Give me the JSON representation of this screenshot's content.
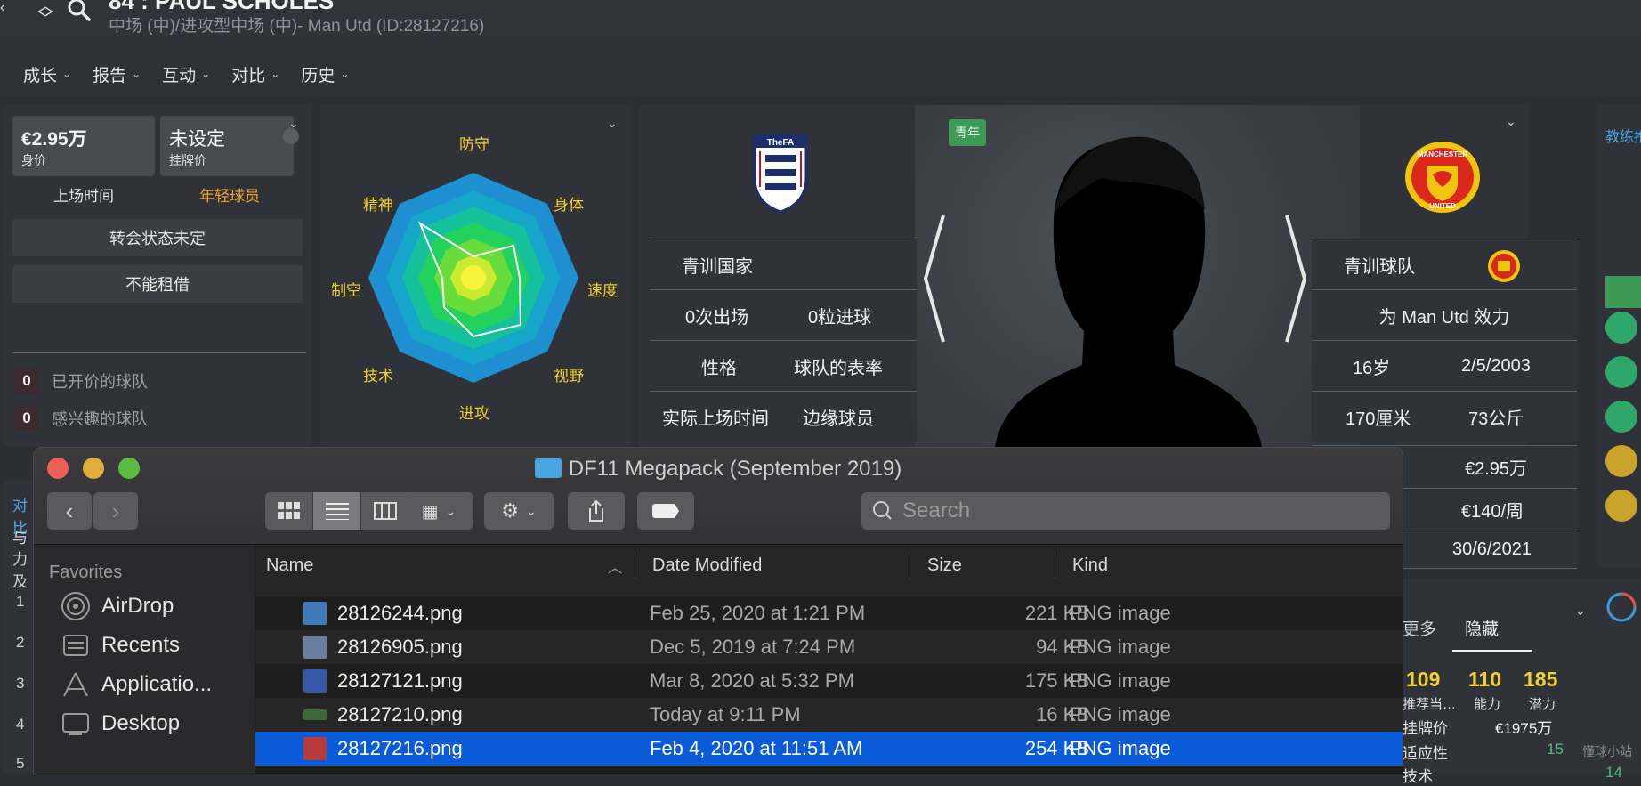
{
  "header": {
    "title": "84 : PAUL SCHOLES",
    "subtitle": "中场 (中)/进攻型中场 (中)- Man Utd (ID:28127216)",
    "nav": [
      "成长",
      "报告",
      "互动",
      "对比",
      "历史"
    ]
  },
  "value_panel": {
    "value": "€2.95万",
    "value_label": "身价",
    "asking": "未设定",
    "asking_label": "挂牌价",
    "playing_time": "上场时间",
    "player_type": "年轻球员",
    "transfer_status": "转会状态未定",
    "loan_status": "不能租借",
    "offers_count": "0",
    "offers_label": "已开价的球队",
    "interest_count": "0",
    "interest_label": "感兴趣的球队"
  },
  "radar": {
    "labels": [
      "防守",
      "身体",
      "速度",
      "视野",
      "进攻",
      "技术",
      "制空",
      "精神"
    ]
  },
  "player_card": {
    "youth_tag": "青年",
    "left_rows": [
      [
        "青训国家",
        ""
      ],
      [
        "0次出场",
        "0粒进球"
      ],
      [
        "性格",
        "球队的表率"
      ],
      [
        "实际上场时间",
        "边缘球员"
      ]
    ],
    "right_rows": [
      [
        "青训球队",
        ""
      ],
      [
        "为 Man Utd 效力",
        ""
      ],
      [
        "16岁",
        "2/5/2003"
      ],
      [
        "170厘米",
        "73公斤"
      ],
      [
        "",
        "€2.95万"
      ],
      [
        "",
        "€140/周"
      ],
      [
        "",
        "30/6/2021"
      ]
    ],
    "fa_text": "TheFA",
    "club_text_top": "MANCHESTER",
    "club_text_bottom": "UNITED"
  },
  "right_edge": {
    "coach_label": "教练推",
    "tab_more": "更多",
    "tab_hidden": "隐藏",
    "stats": [
      {
        "value": "109",
        "label": "推荐当…"
      },
      {
        "value": "110",
        "label": "能力"
      },
      {
        "value": "185",
        "label": "潜力"
      }
    ],
    "asking_label": "挂牌价",
    "asking_value": "€1975万",
    "adapt_label": "适应性",
    "adapt_value": "15",
    "next_label": "技术",
    "next_value": "14",
    "watermark": "懂球小站"
  },
  "bg_partial": {
    "left_labels": [
      "对比",
      "与",
      "力及"
    ],
    "row_numbers": [
      "1",
      "2",
      "3",
      "4",
      "5"
    ]
  },
  "finder": {
    "title": "DF11 Megapack (September 2019)",
    "search_placeholder": "Search",
    "sidebar_heading": "Favorites",
    "sidebar_items": [
      "AirDrop",
      "Recents",
      "Applicatio...",
      "Desktop"
    ],
    "columns": {
      "name": "Name",
      "date": "Date Modified",
      "size": "Size",
      "kind": "Kind"
    },
    "files": [
      {
        "name": "28126244.png",
        "date": "Feb 25, 2020 at 1:21 PM",
        "size": "221 KB",
        "kind": "PNG image"
      },
      {
        "name": "28126905.png",
        "date": "Dec 5, 2019 at 7:24 PM",
        "size": "94 KB",
        "kind": "PNG image"
      },
      {
        "name": "28127121.png",
        "date": "Mar 8, 2020 at 5:32 PM",
        "size": "175 KB",
        "kind": "PNG image"
      },
      {
        "name": "28127210.png",
        "date": "Today at 9:11 PM",
        "size": "16 KB",
        "kind": "PNG image"
      },
      {
        "name": "28127216.png",
        "date": "Feb 4, 2020 at 11:51 AM",
        "size": "254 KB",
        "kind": "PNG image"
      }
    ]
  },
  "colors": {
    "accent_yellow": "#f2d12a",
    "selection_blue": "#0a5bd8",
    "youth_green": "#3d9a54"
  }
}
